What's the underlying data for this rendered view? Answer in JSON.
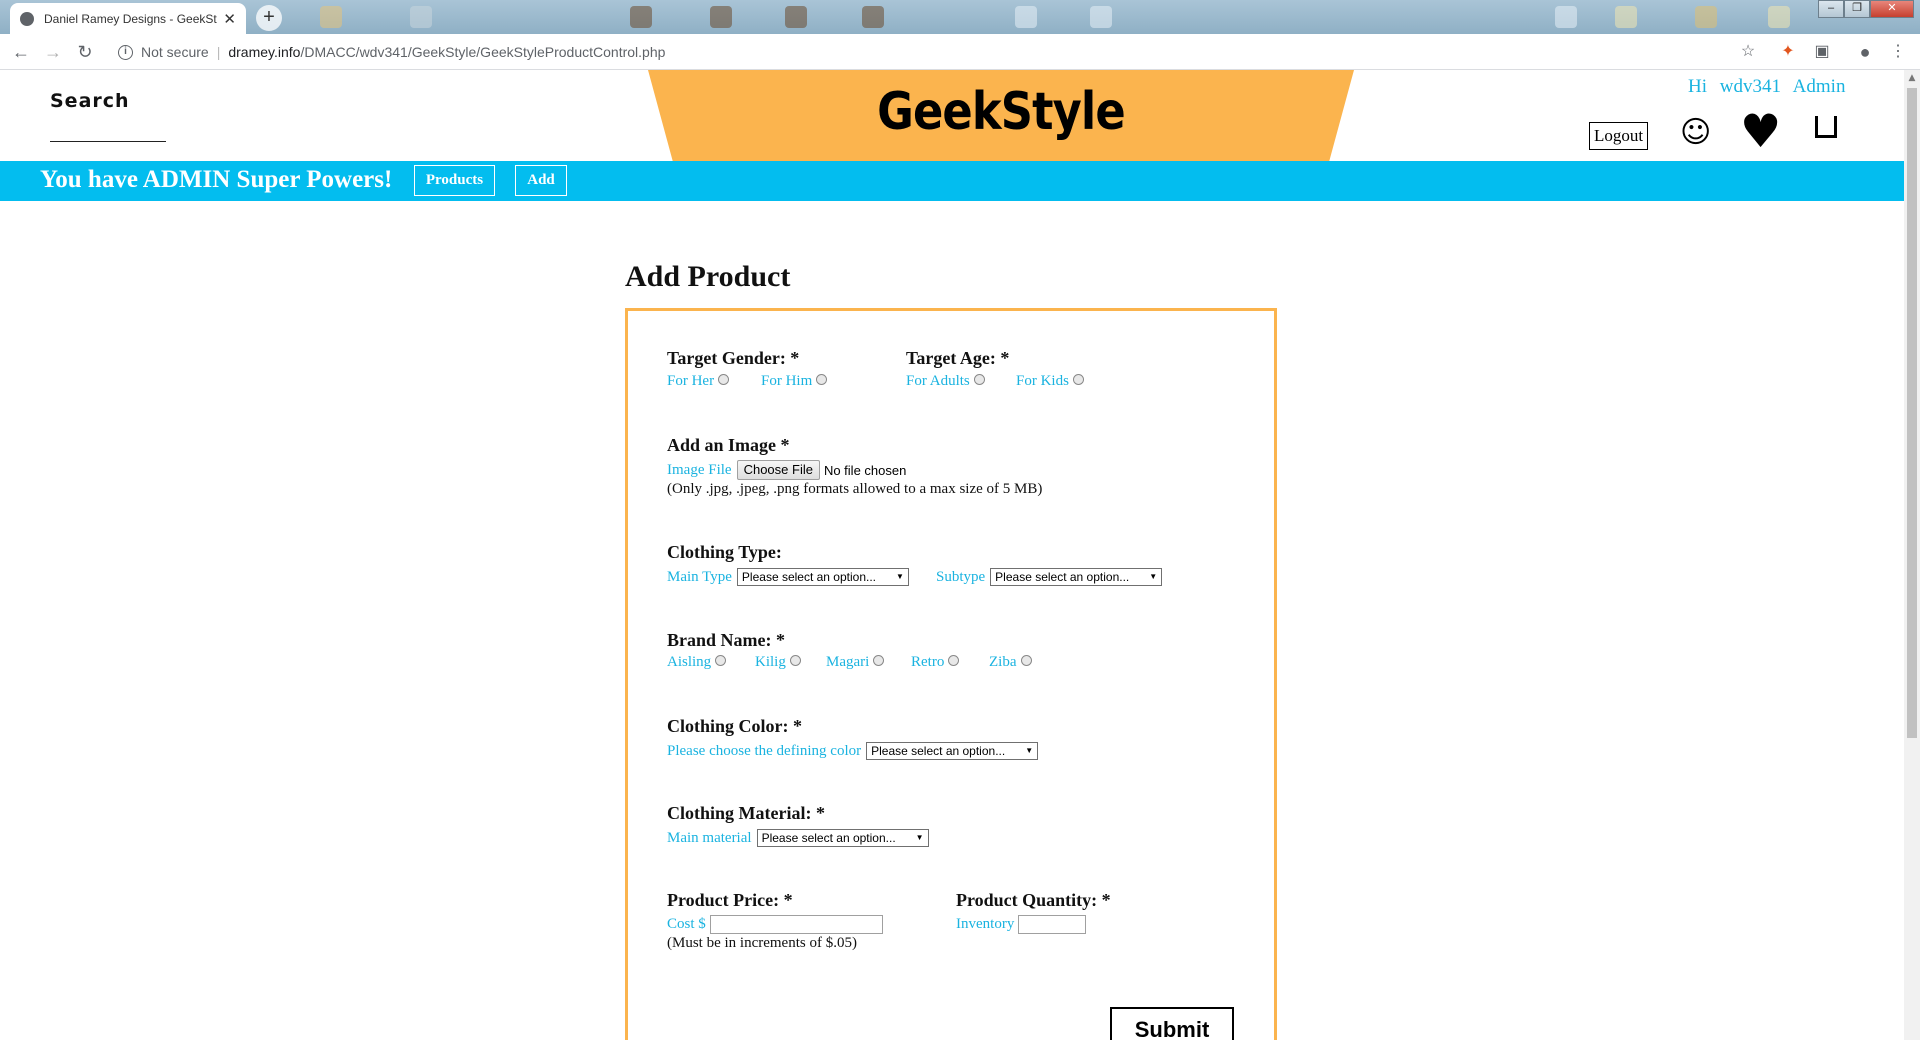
{
  "browser": {
    "tab_title": "Daniel Ramey Designs - GeekStyle",
    "tab_close": "✕",
    "new_tab": "+",
    "security_label": "Not secure",
    "url_domain": "dramey.info",
    "url_path": "/DMACC/wdv341/GeekStyle/GeekStyleProductControl.php",
    "window_controls": [
      "–",
      "❐",
      "✕"
    ]
  },
  "header": {
    "search_label": "Search",
    "logo": "GeekStyle",
    "greeting": "Hi wdv341 Admin",
    "logout_label": "Logout",
    "icons": [
      "smiley-icon",
      "heart-icon",
      "shopping-bag-icon"
    ]
  },
  "admin_bar": {
    "text": "You have ADMIN Super Powers!",
    "products_label": "Products",
    "add_label": "Add",
    "color": "#03bdef"
  },
  "form": {
    "heading": "Add Product",
    "target_gender": {
      "label": "Target Gender: *",
      "options": [
        "For Her",
        "For Him"
      ]
    },
    "target_age": {
      "label": "Target Age: *",
      "options": [
        "For Adults",
        "For Kids"
      ]
    },
    "image": {
      "label": "Add an Image *",
      "field_label": "Image File",
      "button_label": "Choose File",
      "status": "No file chosen",
      "note": "(Only .jpg, .jpeg, .png formats allowed to a max size of 5 MB)"
    },
    "clothing_type": {
      "label": "Clothing Type:",
      "main_label": "Main Type",
      "main_value": "Please select an option...",
      "sub_label": "Subtype",
      "sub_value": "Please select an option..."
    },
    "brand": {
      "label": "Brand Name: *",
      "options": [
        "Aisling",
        "Kilig",
        "Magari",
        "Retro",
        "Ziba"
      ]
    },
    "color": {
      "label": "Clothing Color: *",
      "field_label": "Please choose the defining color",
      "value": "Please select an option..."
    },
    "material": {
      "label": "Clothing Material: *",
      "field_label": "Main material",
      "value": "Please select an option..."
    },
    "price": {
      "label": "Product Price: *",
      "field_label": "Cost $",
      "value": "",
      "note": "(Must be in increments of $.05)"
    },
    "quantity": {
      "label": "Product Quantity: *",
      "field_label": "Inventory",
      "value": ""
    },
    "submit_label": "Submit"
  },
  "colors": {
    "accent_orange": "#fbb44e",
    "accent_blue": "#1ab3e0"
  }
}
